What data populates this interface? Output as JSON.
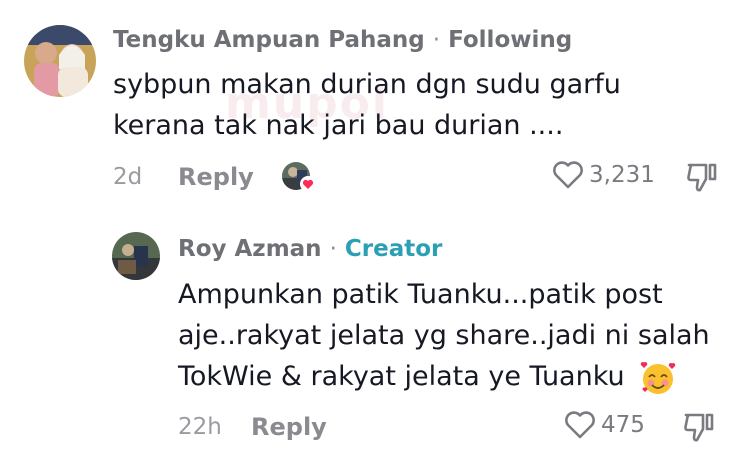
{
  "watermark": "mupol",
  "comments": [
    {
      "author": "Tengku Ampuan Pahang",
      "separator": "·",
      "tag": "Following",
      "text_lines": [
        "sybpun makan durian dgn sudu garfu",
        "kerana tak nak jari bau durian ...."
      ],
      "time": "2d",
      "reply_label": "Reply",
      "likes": "3,231"
    },
    {
      "author": "Roy Azman",
      "separator": "·",
      "tag": "Creator",
      "text_lines": [
        "Ampunkan patik Tuanku...patik post",
        "aje..rakyat jelata yg share..jadi ni salah",
        "TokWie & rakyat jelata ye Tuanku"
      ],
      "emoji": "smiling-face-with-hearts",
      "time": "22h",
      "reply_label": "Reply",
      "likes": "475"
    }
  ],
  "icons": {
    "heart": "heart-outline-icon",
    "dislike": "thumbs-down-icon",
    "liked_by": "creator-liked-avatar-icon"
  },
  "colors": {
    "creator": "#2b9fb3",
    "heart_badge": "#fe2c55"
  }
}
